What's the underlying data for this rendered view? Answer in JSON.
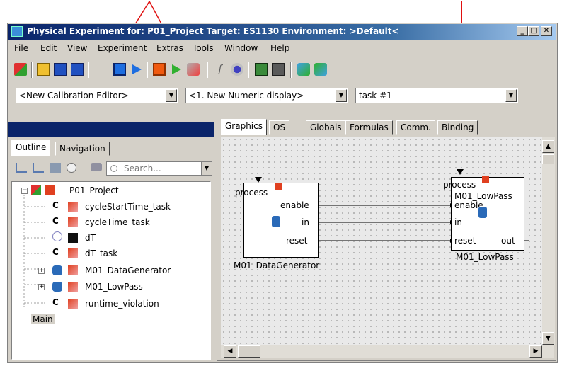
{
  "window": {
    "title": "Physical Experiment for: P01_Project  Target: ES1130  Environment: >Default<",
    "min_label": "_",
    "max_label": "□",
    "close_label": "✕"
  },
  "menu": [
    "File",
    "Edit",
    "View",
    "Experiment",
    "Extras",
    "Tools",
    "Window",
    "Help"
  ],
  "selectors": {
    "calibration_editor": "<New Calibration Editor>",
    "numeric_display": "<1. New Numeric display>",
    "task": "task  #1"
  },
  "left_tabs": [
    "Outline",
    "Navigation"
  ],
  "search": {
    "placeholder": "Search..."
  },
  "tree": {
    "root": "P01_Project",
    "items": [
      "cycleStartTime_task",
      "cycleTime_task",
      "dT",
      "dT_task",
      "M01_DataGenerator",
      "M01_LowPass",
      "runtime_violation"
    ],
    "footer": "Main"
  },
  "graphic_tabs": [
    "Graphics",
    "OS",
    "Globals",
    "Formulas",
    "Comm.",
    "Binding"
  ],
  "diagram": {
    "block1": {
      "name": "M01_DataGenerator",
      "process": "process",
      "ports": [
        "enable",
        "in",
        "reset"
      ]
    },
    "block2": {
      "name": "M01_LowPass",
      "process": "process",
      "ports": [
        "enable",
        "in",
        "reset"
      ],
      "out": "out"
    }
  },
  "colors": {
    "title_start": "#0a246a",
    "annotation_arrow": "#e01010",
    "left_header": "#0a246a"
  }
}
